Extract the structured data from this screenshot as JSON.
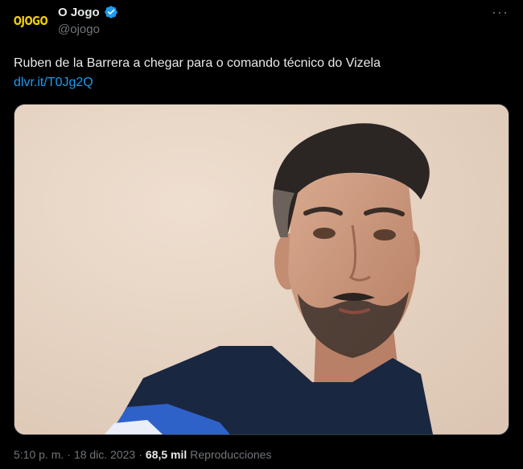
{
  "account": {
    "display_name": "O Jogo",
    "handle": "@ojogo",
    "avatar_text": "OJOGO",
    "verified_color": "#1d9bf0"
  },
  "tweet": {
    "text": "Ruben de la Barrera a chegar para o comando técnico do Vizela",
    "link": "dlvr.it/T0Jg2Q",
    "link_color": "#1d9bf0"
  },
  "media": {
    "alt": "Photo of a man with short dark hair and beard wearing a dark navy shirt with blue and white stripes"
  },
  "meta": {
    "time": "5:10 p. m.",
    "separator": "·",
    "date": "18 dic. 2023",
    "views_count": "68,5 mil",
    "views_label": "Reproducciones"
  },
  "icons": {
    "more": "more-icon",
    "verified": "verified-badge-icon"
  }
}
